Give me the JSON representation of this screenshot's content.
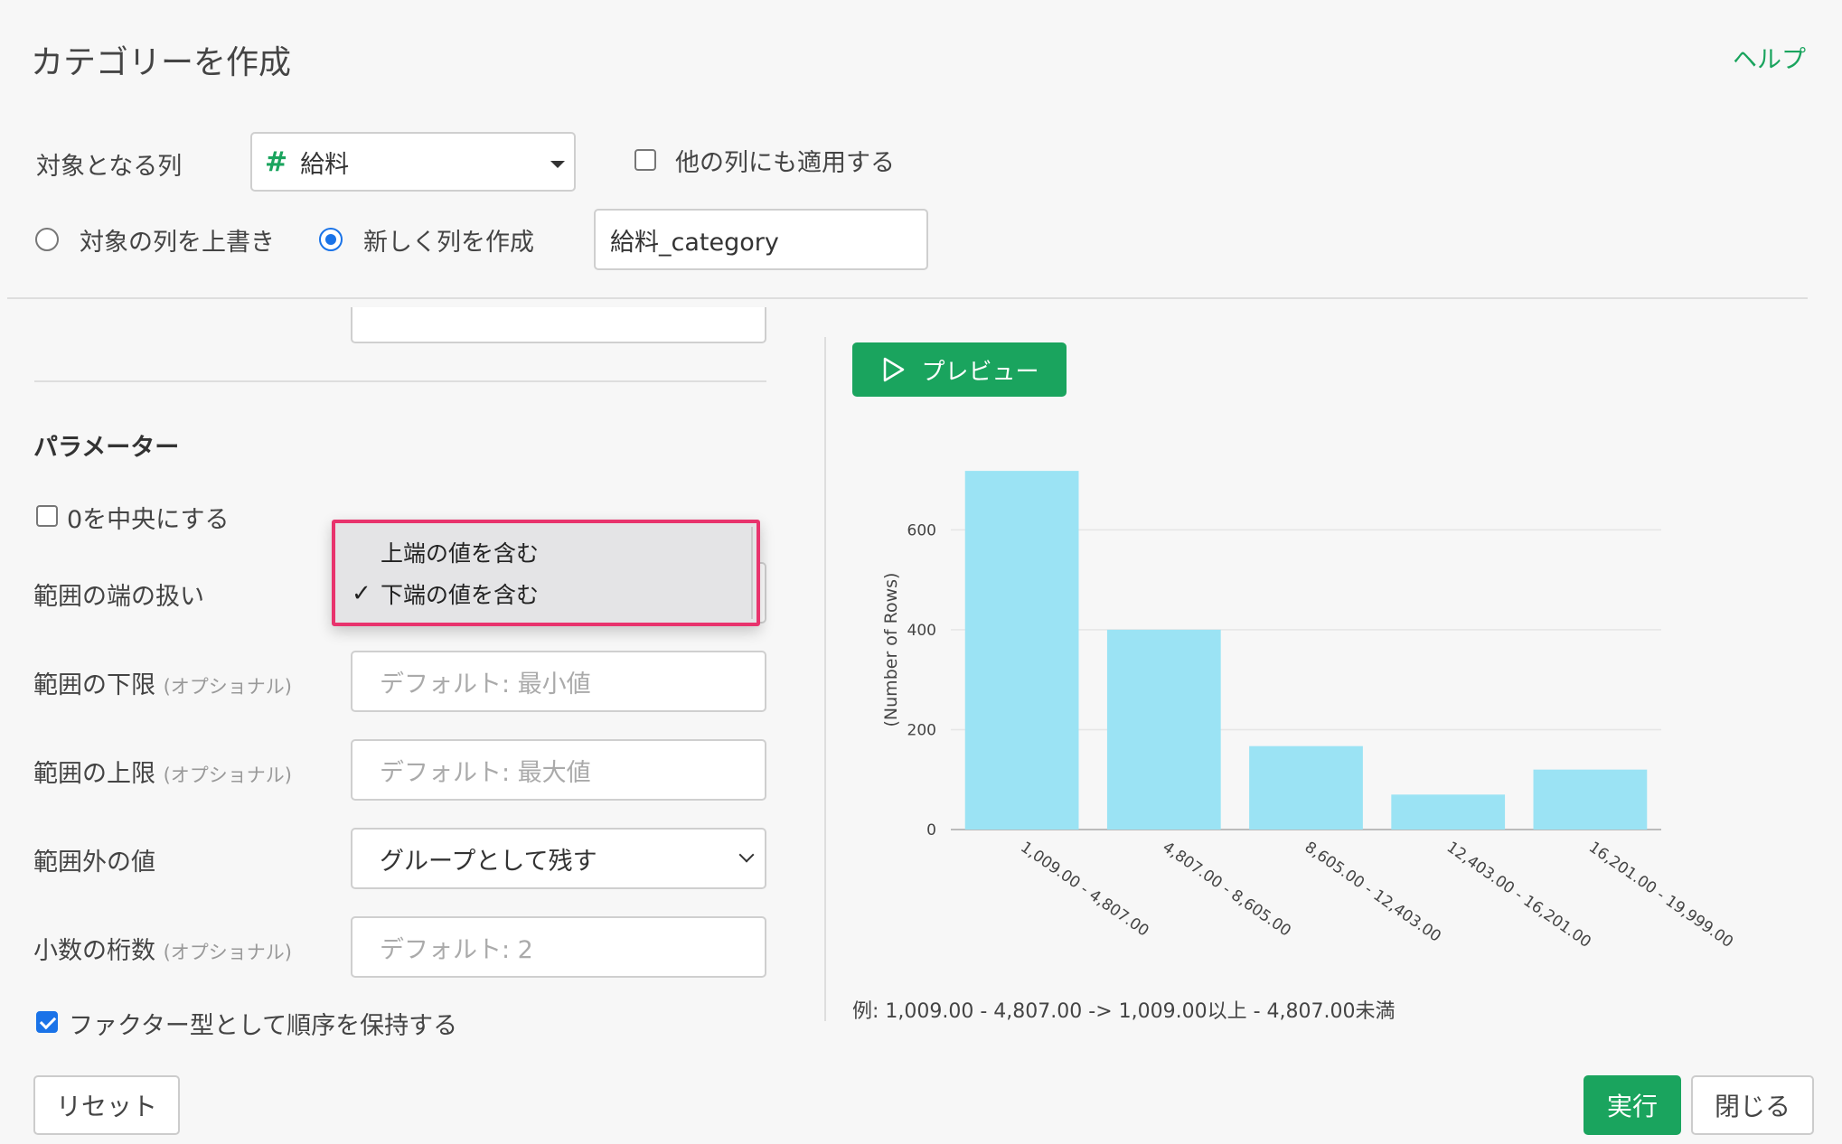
{
  "dialog": {
    "title": "カテゴリーを作成",
    "help_label": "ヘルプ"
  },
  "target_column": {
    "label": "対象となる列",
    "type_icon": "#",
    "value": "給料",
    "apply_other_label": "他の列にも適用する",
    "apply_other_checked": false
  },
  "output_mode": {
    "overwrite_label": "対象の列を上書き",
    "new_column_label": "新しく列を作成",
    "selected": "new_column",
    "new_column_name": "給料_category"
  },
  "parameters": {
    "heading": "パラメーター",
    "center_zero_label": "0を中央にする",
    "center_zero_checked": false,
    "edge_handling_label": "範囲の端の扱い",
    "edge_options": [
      "上端の値を含む",
      "下端の値を含む"
    ],
    "edge_selected_index": 1,
    "lower_label": "範囲の下限",
    "lower_optional": "(オプショナル)",
    "lower_placeholder": "デフォルト: 最小値",
    "upper_label": "範囲の上限",
    "upper_optional": "(オプショナル)",
    "upper_placeholder": "デフォルト: 最大値",
    "outside_label": "範囲外の値",
    "outside_value": "グループとして残す",
    "decimals_label": "小数の桁数",
    "decimals_optional": "(オプショナル)",
    "decimals_placeholder": "デフォルト: 2",
    "keep_order_label": "ファクター型として順序を保持する",
    "keep_order_checked": true
  },
  "preview": {
    "button_label": "プレビュー",
    "example_note": "例: 1,009.00 - 4,807.00 -> 1,009.00以上 - 4,807.00未満"
  },
  "footer": {
    "reset_label": "リセット",
    "run_label": "実行",
    "close_label": "閉じる"
  },
  "colors": {
    "accent_green": "#1aa45e",
    "bar_color": "#9be3f4",
    "highlight_border": "#e8336d"
  },
  "chart_data": {
    "type": "bar",
    "categories": [
      "1,009.00 - 4,807.00",
      "4,807.00 - 8,605.00",
      "8,605.00 - 12,403.00",
      "12,403.00 - 16,201.00",
      "16,201.00 - 19,999.00"
    ],
    "values": [
      718,
      400,
      167,
      70,
      120
    ],
    "ylabel": "(Number of Rows)",
    "yticks": [
      0,
      200,
      400,
      600
    ],
    "ylim": [
      0,
      720
    ],
    "grid": true
  }
}
